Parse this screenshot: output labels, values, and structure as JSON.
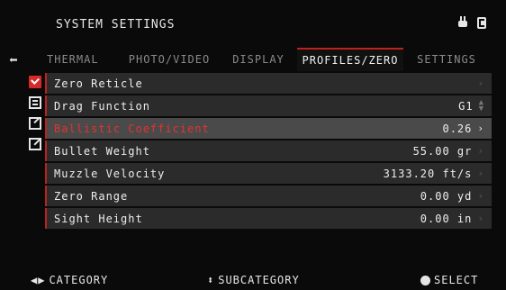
{
  "header": {
    "title": "SYSTEM SETTINGS"
  },
  "tabs": [
    {
      "label": "THERMAL"
    },
    {
      "label": "PHOTO/VIDEO"
    },
    {
      "label": "DISPLAY"
    },
    {
      "label": "PROFILES/ZERO"
    },
    {
      "label": "SETTINGS"
    }
  ],
  "menu": {
    "rows": [
      {
        "label": "Zero Reticle",
        "value": ""
      },
      {
        "label": "Drag Function",
        "value": "G1"
      },
      {
        "label": "Ballistic Coefficient",
        "value": "0.26"
      },
      {
        "label": "Bullet Weight",
        "value": "55.00 gr"
      },
      {
        "label": "Muzzle Velocity",
        "value": "3133.20 ft/s"
      },
      {
        "label": "Zero Range",
        "value": "0.00 yd"
      },
      {
        "label": "Sight Height",
        "value": "0.00 in"
      }
    ]
  },
  "footer": {
    "category": "CATEGORY",
    "subcategory": "SUBCATEGORY",
    "select": "SELECT"
  },
  "colors": {
    "accent": "#c0201e",
    "row_bg": "#2b2b2b",
    "selected_bg": "#4a4a4a"
  },
  "icons": [
    "plug-icon",
    "sd-card-icon",
    "back-arrow-icon",
    "checkbox-icon",
    "grid-icon",
    "edit-icon",
    "external-icon"
  ]
}
